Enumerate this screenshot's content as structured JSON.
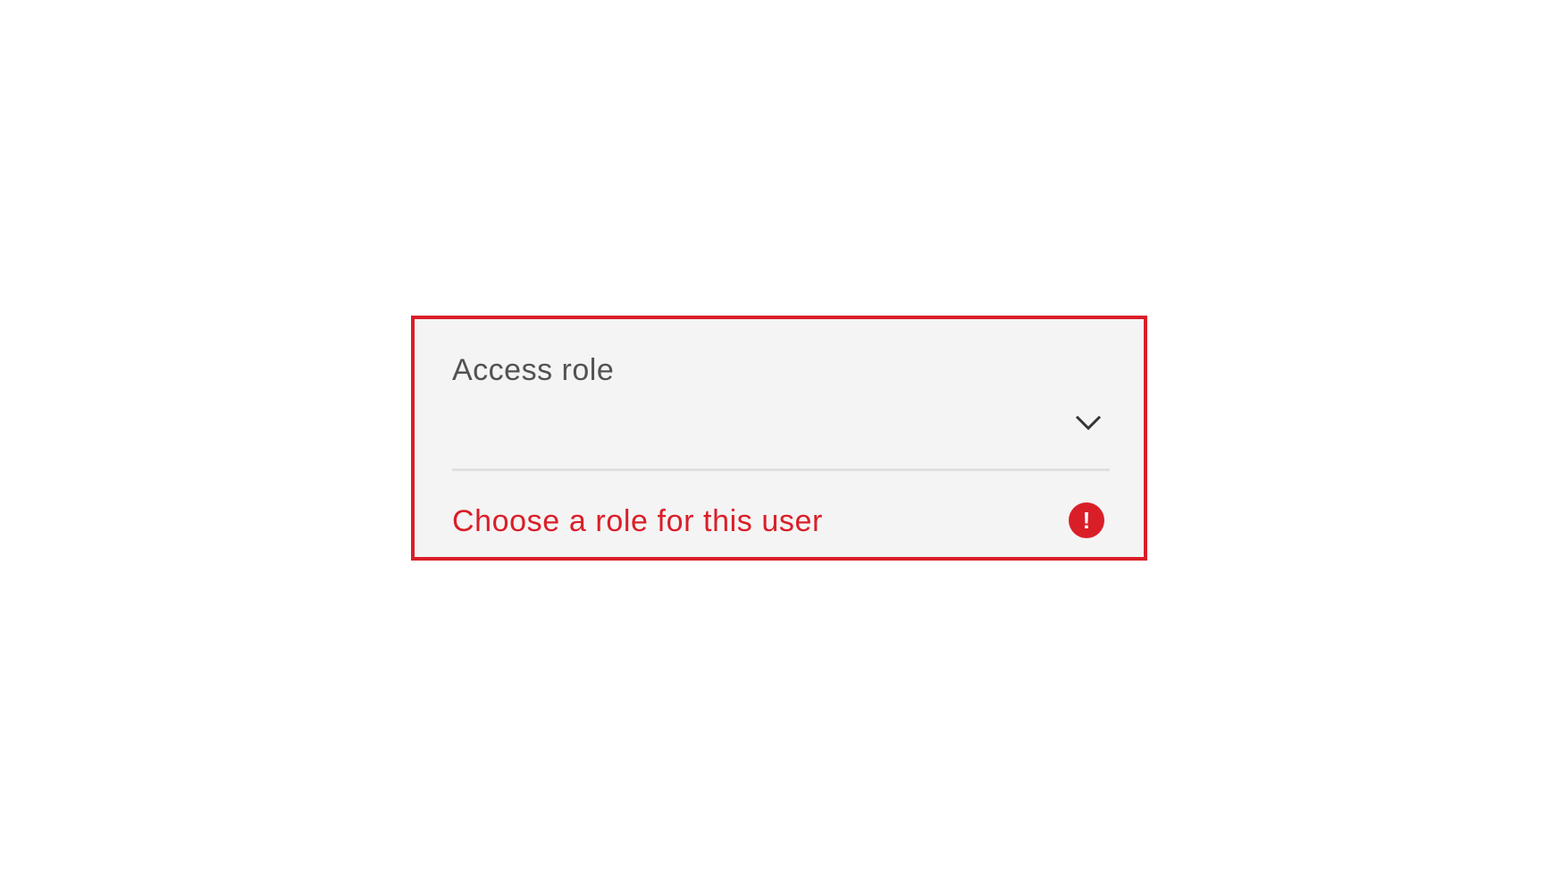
{
  "dropdown": {
    "label": "Access role",
    "selected_value": "",
    "error_message": "Choose a role for this user",
    "chevron_icon": "chevron-down-icon",
    "error_icon": "error-filled-icon",
    "exclamation": "!"
  },
  "colors": {
    "error": "#da1e28",
    "field_background": "#f4f4f4",
    "label_text": "#525252",
    "divider": "#e0e0e0"
  }
}
